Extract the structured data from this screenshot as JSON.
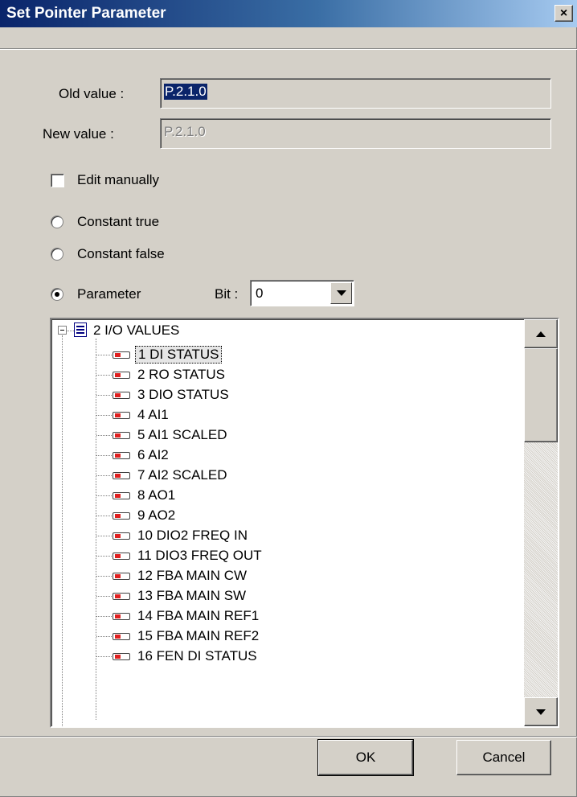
{
  "window": {
    "title": "Set Pointer Parameter",
    "close_glyph": "×"
  },
  "old_value": {
    "label": "Old value :",
    "value": "P.2.1.0"
  },
  "new_value": {
    "label": "New value :",
    "value": "P.2.1.0"
  },
  "edit_manually": {
    "label": "Edit manually",
    "checked": false
  },
  "radios": {
    "constant_true": {
      "label": "Constant true",
      "selected": false
    },
    "constant_false": {
      "label": "Constant false",
      "selected": false
    },
    "parameter": {
      "label": "Parameter",
      "selected": true
    }
  },
  "bit": {
    "label": "Bit :",
    "value": "0"
  },
  "tree": {
    "group": {
      "label": "2 I/O VALUES",
      "icon": "parameter-group-icon",
      "expanded": true
    },
    "items": [
      "1 DI STATUS",
      "2 RO STATUS",
      "3 DIO STATUS",
      "4 AI1",
      "5 AI1 SCALED",
      "6 AI2",
      "7 AI2 SCALED",
      "8 AO1",
      "9 AO2",
      "10 DIO2 FREQ IN",
      "11 DIO3 FREQ OUT",
      "12 FBA MAIN CW",
      "13 FBA MAIN SW",
      "14 FBA MAIN REF1",
      "15 FBA MAIN REF2",
      "16 FEN DI STATUS"
    ],
    "selected_item": "1 DI STATUS"
  },
  "buttons": {
    "ok": "OK",
    "cancel": "Cancel"
  },
  "colors": {
    "title_start": "#0a246a",
    "title_end": "#a6caf0",
    "face": "#d4d0c8",
    "selection": "#0a246a",
    "param_icon": "#e02020"
  }
}
